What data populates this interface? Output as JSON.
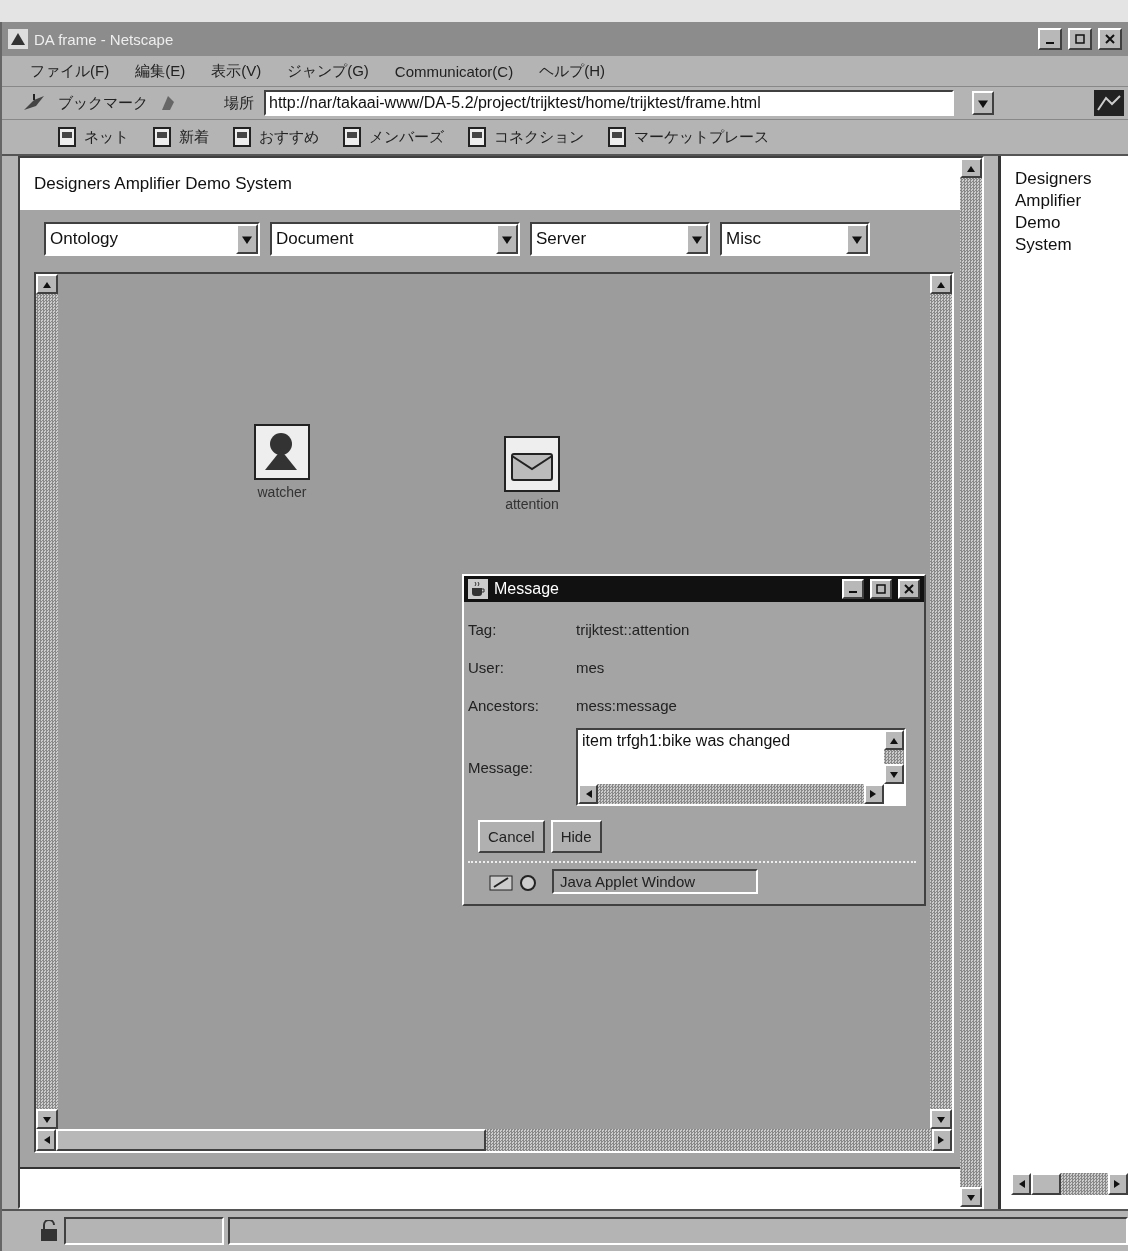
{
  "window": {
    "title": "DA frame - Netscape"
  },
  "menu_bar": [
    "ファイル(F)",
    "編集(E)",
    "表示(V)",
    "ジャンプ(G)",
    "Communicator(C)",
    "ヘルプ(H)"
  ],
  "location_bar": {
    "bookmarks": "ブックマーク",
    "label": "場所",
    "url": "http://nar/takaai-www/DA-5.2/project/trijktest/home/trijktest/frame.html"
  },
  "personal_toolbar": [
    "ネット",
    "新着",
    "おすすめ",
    "メンバーズ",
    "コネクション",
    "マーケットプレース"
  ],
  "main_frame": {
    "title": "Designers Amplifier Demo System",
    "menus": [
      "Ontology",
      "Document",
      "Server",
      "Misc"
    ],
    "canvas_items": [
      {
        "label": "watcher",
        "kind": "person"
      },
      {
        "label": "attention",
        "kind": "mail"
      }
    ]
  },
  "dialog": {
    "title": "Message",
    "fields": [
      {
        "label": "Tag:",
        "value": "trijktest::attention"
      },
      {
        "label": "User:",
        "value": "mes"
      },
      {
        "label": "Ancestors:",
        "value": "mess:message"
      }
    ],
    "message_label": "Message:",
    "message": "item trfgh1:bike was changed",
    "buttons": [
      "Cancel",
      "Hide"
    ],
    "status": "Java Applet Window"
  },
  "side_frame": {
    "lines": [
      "Designers",
      "Amplifier",
      "Demo",
      "System"
    ]
  }
}
